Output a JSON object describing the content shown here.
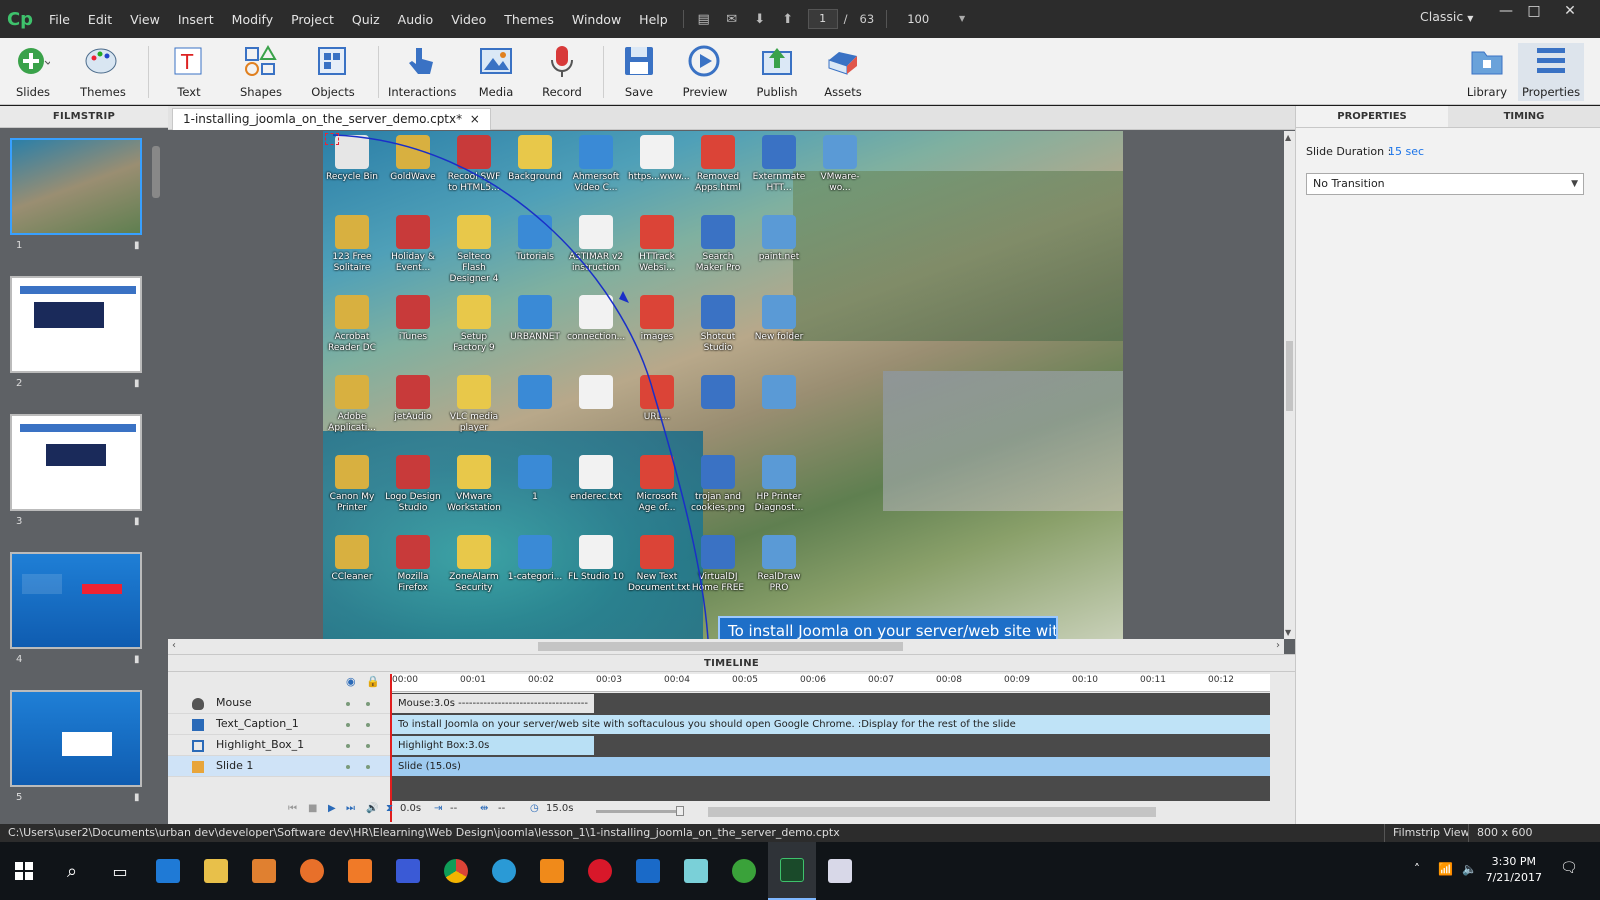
{
  "app": {
    "logo": "Cp",
    "workspace": "Classic",
    "min": "—",
    "max": "□",
    "close": "✕"
  },
  "menu": [
    "File",
    "Edit",
    "View",
    "Insert",
    "Modify",
    "Project",
    "Quiz",
    "Audio",
    "Video",
    "Themes",
    "Window",
    "Help"
  ],
  "nav": {
    "page": "1",
    "sep": "/",
    "total": "63",
    "zoom": "100"
  },
  "toolbar": {
    "items": [
      {
        "label": "Slides",
        "icon": "add-slide-icon"
      },
      {
        "label": "Themes",
        "icon": "palette-icon"
      },
      {
        "label": "Text",
        "icon": "text-icon"
      },
      {
        "label": "Shapes",
        "icon": "shapes-icon"
      },
      {
        "label": "Objects",
        "icon": "objects-icon"
      },
      {
        "label": "Interactions",
        "icon": "hand-pointer-icon"
      },
      {
        "label": "Media",
        "icon": "image-icon"
      },
      {
        "label": "Record",
        "icon": "microphone-icon"
      },
      {
        "label": "Save",
        "icon": "save-icon"
      },
      {
        "label": "Preview",
        "icon": "play-icon"
      },
      {
        "label": "Publish",
        "icon": "publish-icon"
      },
      {
        "label": "Assets",
        "icon": "assets-icon"
      },
      {
        "label": "Library",
        "icon": "library-icon"
      },
      {
        "label": "Properties",
        "icon": "properties-icon"
      }
    ]
  },
  "filmstrip": {
    "title": "FILMSTRIP",
    "slides": [
      "1",
      "2",
      "3",
      "4",
      "5"
    ]
  },
  "document": {
    "tab": "1-installing_joomla_on_the_server_demo.cptx*",
    "close": "×"
  },
  "desktop_icons": [
    "Recycle Bin",
    "GoldWave",
    "Recool SWF to HTML5...",
    "Background",
    "Ahmersoft Video C...",
    "https...www...",
    "Removed Apps.html",
    "Externmate HTT...",
    "VMware-wo...",
    "123 Free Solitaire",
    "Holiday & Event...",
    "Selteco Flash Designer 4",
    "Tutorials",
    "ASTIMAR v2 instruction",
    "HTTrack Websi...",
    "Search Maker Pro",
    "paint.net",
    "Acrobat Reader DC",
    "iTunes",
    "Setup Factory 9",
    "URBANNET",
    "connection...",
    "images",
    "Shotcut Studio",
    "New folder",
    "Adobe Applicati...",
    "jetAudio",
    "VLC media player",
    "",
    "",
    "URL...",
    "",
    "",
    "Canon My Printer",
    "Logo Design Studio",
    "VMware Workstation",
    "1",
    "enderec.txt",
    "Microsoft Age of...",
    "trojan and cookies.png",
    "HP Printer Diagnost...",
    "CCleaner",
    "Mozilla Firefox",
    "ZoneAlarm Security",
    "1-categori...",
    "FL Studio 10",
    "New Text Document.txt",
    "VirtualDJ Home FREE",
    "RealDraw PRO"
  ],
  "caption_text": "To install Joomla on your server/web site with",
  "properties": {
    "tab1": "PROPERTIES",
    "tab2": "TIMING",
    "duration_label": "Slide Duration :",
    "duration_value": "15 sec",
    "transition": "No Transition"
  },
  "timeline": {
    "title": "TIMELINE",
    "ticks": [
      "00:00",
      "00:01",
      "00:02",
      "00:03",
      "00:04",
      "00:05",
      "00:06",
      "00:07",
      "00:08",
      "00:09",
      "00:10",
      "00:11",
      "00:12"
    ],
    "rows": [
      {
        "name": "Mouse",
        "bar": "Mouse:3.0s ------------------------------------",
        "type": "mouse"
      },
      {
        "name": "Text_Caption_1",
        "bar": "To install Joomla on your server/web site with softaculous you should open Google Chrome. :Display for the rest of the slide",
        "type": "caption"
      },
      {
        "name": "Highlight_Box_1",
        "bar": "Highlight Box:3.0s",
        "type": "highlight"
      },
      {
        "name": "Slide 1",
        "bar": "Slide (15.0s)",
        "type": "slide"
      }
    ],
    "ctrl": {
      "time": "0.0s",
      "dur1": "--",
      "dur2": "--",
      "total": "15.0s"
    }
  },
  "status": {
    "path": "C:\\Users\\user2\\Documents\\urban dev\\developer\\Software dev\\HR\\Elearning\\Web Design\\joomla\\lesson_1\\1-installing_joomla_on_the_server_demo.cptx",
    "view": "Filmstrip View",
    "size": "800 x 600"
  },
  "clock": {
    "time": "3:30 PM",
    "date": "7/21/2017"
  },
  "colors": {
    "accent": "#1a73e8",
    "caption_bar": "#bfe3f7",
    "highlight_bar": "#b9e0f5",
    "slide_bar": "#9ecbf0",
    "playhead": "#e01e1e"
  }
}
